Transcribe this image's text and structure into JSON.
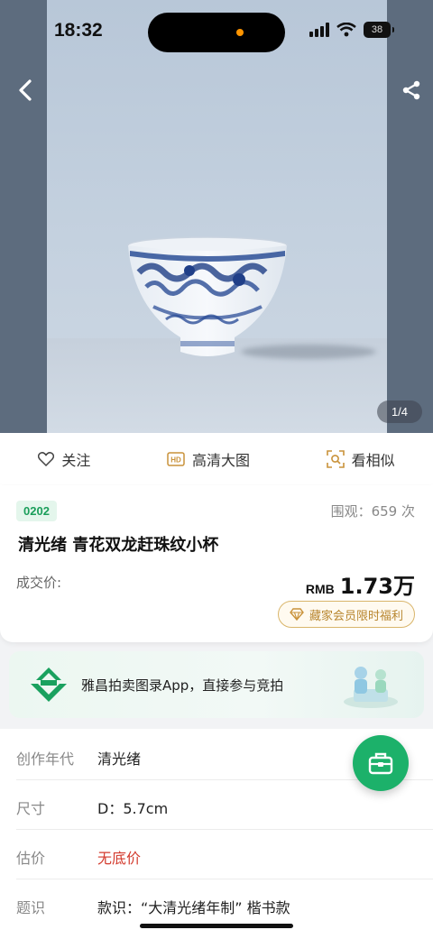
{
  "status_bar": {
    "time": "18:32",
    "battery": "38"
  },
  "gallery": {
    "counter": "1/4"
  },
  "actions": [
    {
      "label": "关注",
      "icon": "heart-icon"
    },
    {
      "label": "高清大图",
      "icon": "hd-icon"
    },
    {
      "label": "看相似",
      "icon": "scan-icon"
    }
  ],
  "lot": {
    "number": "0202",
    "views": "围观：659 次",
    "title": "清光绪 青花双龙赶珠纹小杯",
    "price_label": "成交价:",
    "currency": "RMB",
    "price": "1.73万",
    "member_benefit": "藏家会员限时福利"
  },
  "banner": {
    "text": "雅昌拍卖图录App，直接参与竞拍"
  },
  "details": [
    {
      "key": "创作年代",
      "value": "清光绪"
    },
    {
      "key": "尺寸",
      "value": "D：5.7cm"
    },
    {
      "key": "估价",
      "value": "无底价"
    },
    {
      "key": "题识",
      "value": "款识：“大清光绪年制” 楷书款"
    }
  ],
  "colors": {
    "accent_green": "#1cb16a",
    "price_red": "#d33b2e",
    "gold": "#b8862f"
  }
}
